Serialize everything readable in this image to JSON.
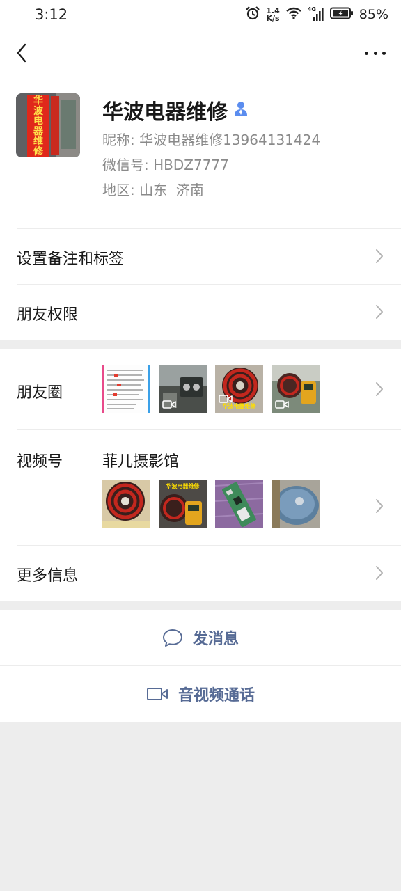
{
  "status_bar": {
    "time": "3:12",
    "net_speed_value": "1.4",
    "net_speed_unit": "K/s",
    "network_type": "4G",
    "battery_percent": "85%",
    "icons": [
      "alarm-icon",
      "wifi-icon",
      "signal-icon",
      "battery-charging-icon"
    ]
  },
  "nav": {
    "back_icon": "chevron-left-icon",
    "more_icon": "more-dots-icon"
  },
  "profile": {
    "avatar_sign_text": "华波电器维修",
    "display_name": "华波电器维修",
    "verified_icon": "person-verified-icon",
    "nickname_label": "昵称:",
    "nickname_value": "华波电器维修13964131424",
    "wechat_id_label": "微信号:",
    "wechat_id_value": "HBDZ7777",
    "region_label": "地区:",
    "region_value": "山东  济南"
  },
  "settings": {
    "remark_tags_label": "设置备注和标签",
    "friend_permissions_label": "朋友权限"
  },
  "moments": {
    "label": "朋友圈",
    "thumbs": [
      {
        "type": "image",
        "desc": "text-poster"
      },
      {
        "type": "video",
        "desc": "repair-bench"
      },
      {
        "type": "video",
        "desc": "induction-coil",
        "caption": "华波电器维修"
      },
      {
        "type": "video",
        "desc": "multimeter-test"
      }
    ]
  },
  "channels": {
    "label": "视频号",
    "channel_name": "菲儿摄影馆",
    "thumbs": [
      {
        "type": "image",
        "desc": "induction-coil"
      },
      {
        "type": "image",
        "desc": "coil-meter",
        "caption": "华波电器维修"
      },
      {
        "type": "image",
        "desc": "circuit-board"
      },
      {
        "type": "image",
        "desc": "round-cooker"
      }
    ]
  },
  "more_info": {
    "label": "更多信息"
  },
  "actions": {
    "send_message_label": "发消息",
    "video_call_label": "音视频通话",
    "send_message_icon": "chat-bubble-icon",
    "video_call_icon": "video-camera-icon"
  },
  "colors": {
    "link_blue": "#576b95",
    "page_bg": "#ededed",
    "card_bg": "#ffffff",
    "text_primary": "#191919",
    "text_secondary": "#8a8a8a",
    "verified_blue": "#5b8def"
  }
}
